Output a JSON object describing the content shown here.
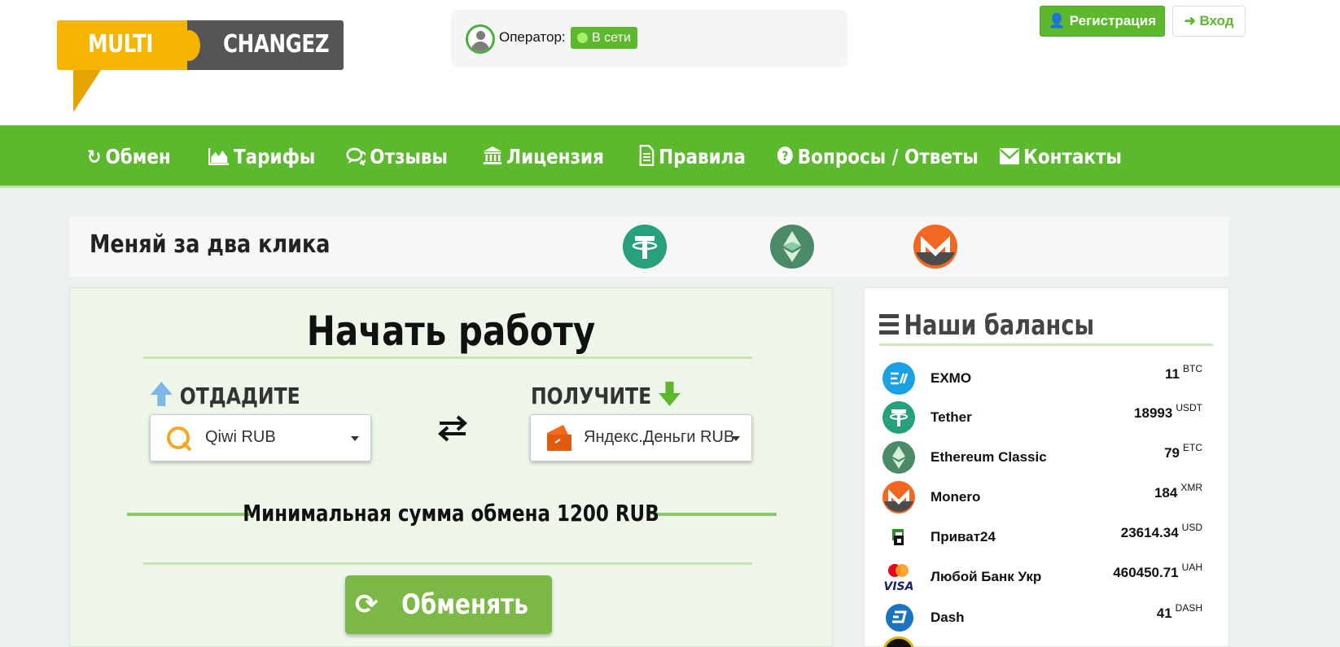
{
  "header": {
    "logo": {
      "word1": "MULTI",
      "word2": "CHANGEZ"
    },
    "operator": {
      "label": "Оператор:",
      "status": "В сети"
    },
    "register_label": "Регистрация",
    "login_label": "Вход",
    "colors": {
      "accent": "#5cb82c",
      "logo_yellow": "#f5b400",
      "logo_gray": "#555557"
    }
  },
  "nav": {
    "items": [
      {
        "label": "Обмен",
        "icon": "refresh-icon"
      },
      {
        "label": "Тарифы",
        "icon": "area-chart-icon"
      },
      {
        "label": "Отзывы",
        "icon": "comments-icon"
      },
      {
        "label": "Лицензия",
        "icon": "bank-icon"
      },
      {
        "label": "Правила",
        "icon": "document-icon"
      },
      {
        "label": "Вопросы / Ответы",
        "icon": "question-circle-icon"
      },
      {
        "label": "Контакты",
        "icon": "envelope-icon"
      }
    ]
  },
  "tagline": {
    "text": "Меняй за два клика",
    "coins": [
      "tether-icon",
      "ethereum-classic-icon",
      "monero-icon"
    ]
  },
  "exchange": {
    "title": "Начать работу",
    "give_label": "ОТДАДИТЕ",
    "get_label": "ПОЛУЧИТЕ",
    "give_selected": "Qiwi RUB",
    "get_selected": "Яндекс.Деньги RUB",
    "min_text": "Минимальная сумма обмена 1200 RUB",
    "button_label": "Обменять"
  },
  "balances": {
    "title": "Наши балансы",
    "items": [
      {
        "name": "EXMO",
        "amount": "11",
        "currency": "BTC",
        "icon": "exmo-icon",
        "color": "#1ba1e2"
      },
      {
        "name": "Tether",
        "amount": "18993",
        "currency": "USDT",
        "icon": "tether-icon",
        "color": "#26a17b"
      },
      {
        "name": "Ethereum Classic",
        "amount": "79",
        "currency": "ETC",
        "icon": "ethereum-classic-icon",
        "color": "#4b8a66"
      },
      {
        "name": "Monero",
        "amount": "184",
        "currency": "XMR",
        "icon": "monero-icon",
        "color": "#f26822"
      },
      {
        "name": "Приват24",
        "amount": "23614.34",
        "currency": "USD",
        "icon": "privat24-icon",
        "color": "#2f8a2a"
      },
      {
        "name": "Любой Банк Укр",
        "amount": "460450.71",
        "currency": "UAH",
        "icon": "mastercard-visa-icon",
        "color": "#1a1f71"
      },
      {
        "name": "Dash",
        "amount": "41",
        "currency": "DASH",
        "icon": "dash-icon",
        "color": "#1c75bc"
      }
    ]
  }
}
